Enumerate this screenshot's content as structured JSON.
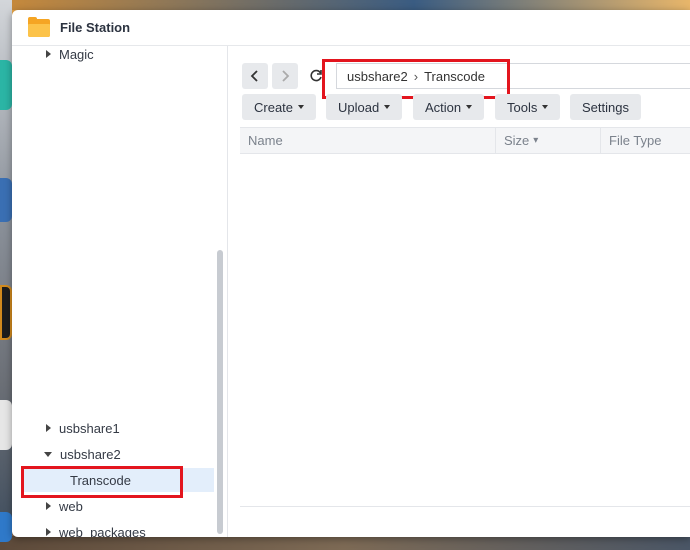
{
  "window": {
    "title": "File Station",
    "icon": "folder-icon"
  },
  "sidebar": {
    "items": [
      {
        "label": "Magic",
        "expanded": false
      },
      {
        "label": "usbshare1",
        "expanded": false
      },
      {
        "label": "usbshare2",
        "expanded": true
      },
      {
        "label": "Transcode",
        "selected": true
      },
      {
        "label": "web",
        "expanded": false
      },
      {
        "label": "web_packages",
        "expanded": false
      }
    ]
  },
  "navigation": {
    "back_icon": "chevron-left-icon",
    "forward_icon": "chevron-right-icon",
    "refresh_icon": "refresh-icon",
    "path": [
      "usbshare2",
      "Transcode"
    ],
    "separator": "›"
  },
  "toolbar": {
    "create": "Create",
    "upload": "Upload",
    "action": "Action",
    "tools": "Tools",
    "settings": "Settings"
  },
  "grid": {
    "columns": [
      "Name",
      "Size",
      "File Type"
    ],
    "sort_indicator": "▾"
  },
  "colors": {
    "highlight": "#e3151e",
    "selected_row": "#e3eefb",
    "folder": "#f5a524"
  }
}
